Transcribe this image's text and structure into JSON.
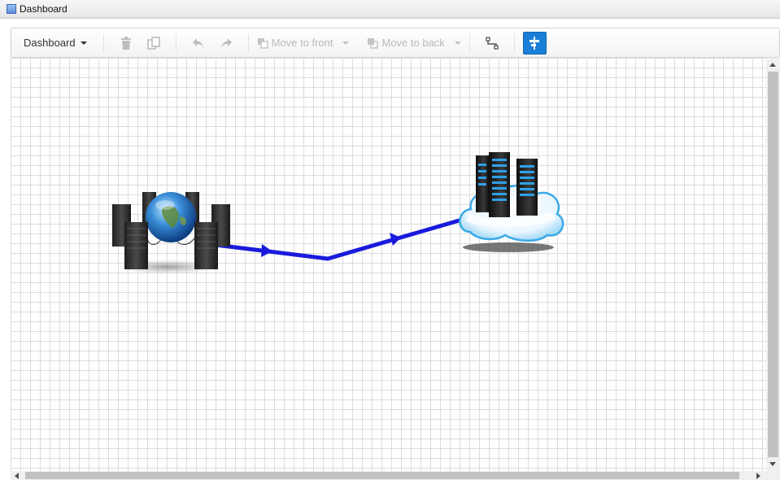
{
  "window": {
    "title": "Dashboard"
  },
  "toolbar": {
    "view_label": "Dashboard",
    "move_to_front_label": "Move to front",
    "move_to_back_label": "Move to back",
    "icons": [
      "trash-icon",
      "copy-icon",
      "undo-icon",
      "redo-icon",
      "connector-icon",
      "snap-to-grid-icon"
    ],
    "active_tool": "snap-to-grid",
    "active_color": "#1a7fd6"
  },
  "canvas": {
    "grid": true,
    "nodes": [
      {
        "kind": "server-cluster-with-globe"
      },
      {
        "kind": "cloud-server-rack"
      }
    ],
    "edges": [
      {
        "from": "server-cluster-with-globe",
        "to": "cloud-server-rack",
        "color": "#1a1adc",
        "arrows": 2
      }
    ]
  }
}
